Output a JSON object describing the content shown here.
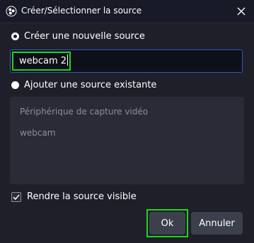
{
  "window": {
    "title": "Créer/Sélectionner la source",
    "icon": "obs-logo-icon",
    "close_icon": "close-icon"
  },
  "create_new": {
    "label": "Créer une nouvelle source",
    "selected": true
  },
  "name_input": {
    "value": "webcam 2"
  },
  "use_existing": {
    "label": "Ajouter une source existante",
    "selected": false
  },
  "existing_sources": [
    {
      "label": "Périphérique de capture vidéo"
    },
    {
      "label": "webcam"
    }
  ],
  "visible_checkbox": {
    "label": "Rendre la source visible",
    "checked": true
  },
  "buttons": {
    "ok": "Ok",
    "cancel": "Annuler"
  },
  "colors": {
    "background": "#1e1f29",
    "titlebar": "#181a28",
    "input_border": "#2d5ac4",
    "highlight": "#21d31e",
    "button": "#3c404d",
    "list_background": "#2a2b36",
    "disabled_text": "#8c8e99"
  }
}
